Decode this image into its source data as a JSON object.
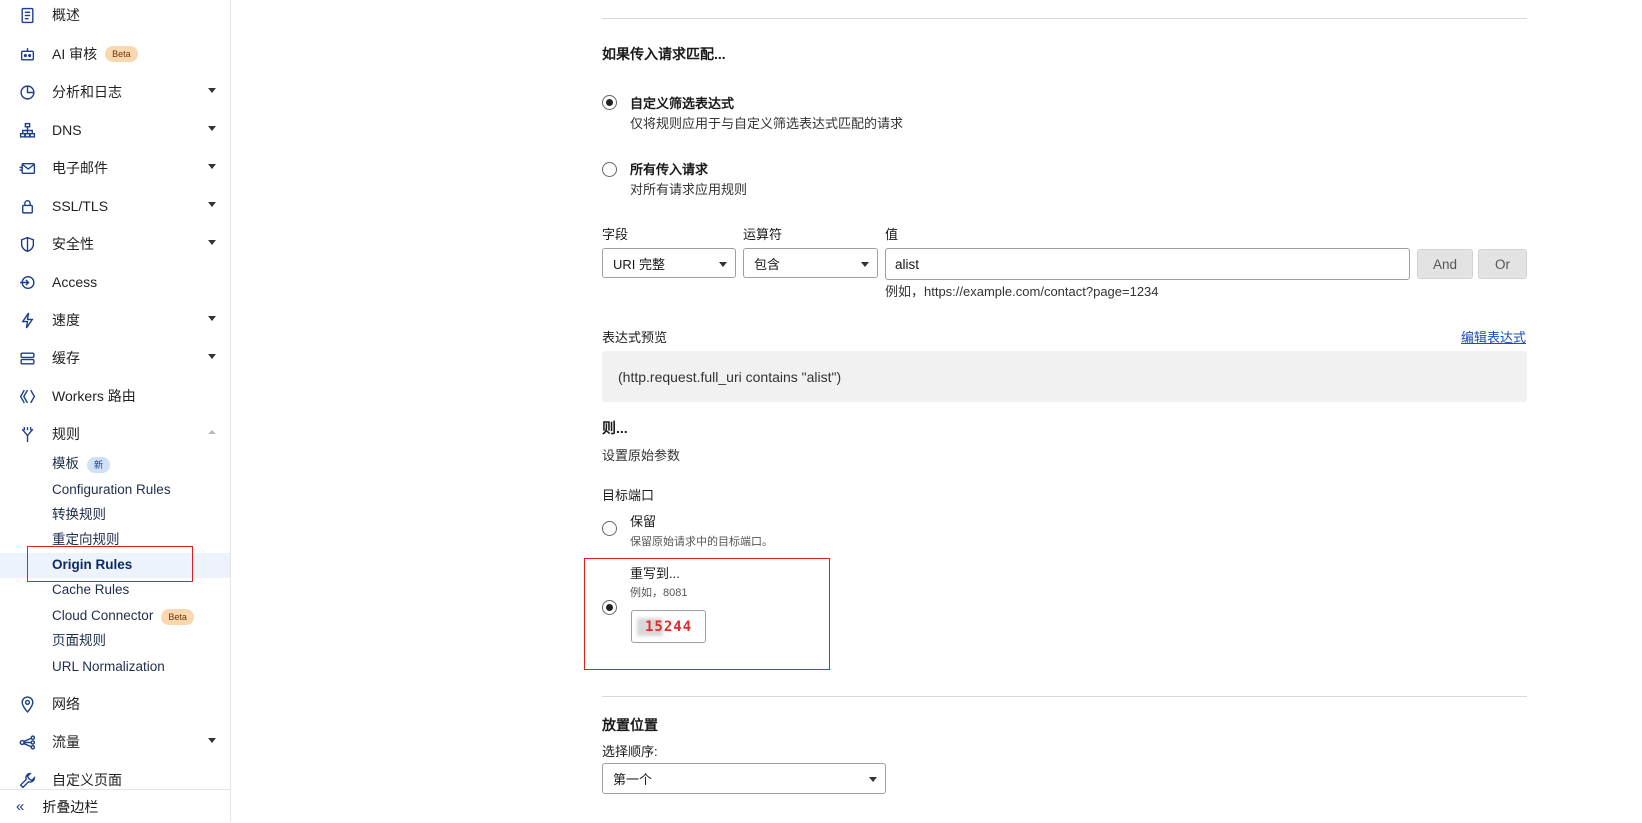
{
  "sidebar": {
    "items": [
      {
        "label": "概述",
        "icon": "document-icon"
      },
      {
        "label": "AI 审核",
        "icon": "robot-icon",
        "badge": "Beta"
      },
      {
        "label": "分析和日志",
        "icon": "chart-pie-icon"
      },
      {
        "label": "DNS",
        "icon": "network-icon"
      },
      {
        "label": "电子邮件",
        "icon": "email-icon"
      },
      {
        "label": "SSL/TLS",
        "icon": "lock-icon"
      },
      {
        "label": "安全性",
        "icon": "shield-icon"
      },
      {
        "label": "Access",
        "icon": "access-icon"
      },
      {
        "label": "速度",
        "icon": "lightning-icon"
      },
      {
        "label": "缓存",
        "icon": "cache-icon"
      },
      {
        "label": "Workers 路由",
        "icon": "workers-icon"
      },
      {
        "label": "规则",
        "icon": "rules-icon"
      },
      {
        "label": "网络",
        "icon": "location-pin-icon"
      },
      {
        "label": "流量",
        "icon": "traffic-icon"
      },
      {
        "label": "自定义页面",
        "icon": "wrench-icon"
      }
    ],
    "rules_sub": [
      {
        "label": "模板",
        "badge": "新"
      },
      {
        "label": "Configuration Rules"
      },
      {
        "label": "转换规则"
      },
      {
        "label": "重定向规则"
      },
      {
        "label": "Origin Rules"
      },
      {
        "label": "Cache Rules"
      },
      {
        "label": "Cloud Connector",
        "badge": "Beta"
      },
      {
        "label": "页面规则"
      },
      {
        "label": "URL Normalization"
      }
    ],
    "collapse_label": "折叠边栏",
    "collapse_icon": "double-chevron-left-icon"
  },
  "main": {
    "match_heading": "如果传入请求匹配...",
    "custom_filter": {
      "title": "自定义筛选表达式",
      "desc": "仅将规则应用于与自定义筛选表达式匹配的请求"
    },
    "all_requests": {
      "title": "所有传入请求",
      "desc": "对所有请求应用规则"
    },
    "field_label": "字段",
    "operator_label": "运算符",
    "value_label": "值",
    "field_value": "URI 完整",
    "operator_value": "包含",
    "value_value": "alist",
    "value_hint": "例如，https://example.com/contact?page=1234",
    "and_label": "And",
    "or_label": "Or",
    "preview_label": "表达式预览",
    "edit_expression": "编辑表达式",
    "preview_text": "(http.request.full_uri contains \"alist\")",
    "then_heading": "则...",
    "then_sub": "设置原始参数",
    "dest_port_label": "目标端口",
    "preserve": {
      "title": "保留",
      "desc": "保留原始请求中的目标端口。"
    },
    "rewrite": {
      "title": "重写到...",
      "desc": "例如，8081"
    },
    "port_value": "15244",
    "placement_heading": "放置位置",
    "order_label": "选择顺序:",
    "order_value": "第一个"
  },
  "colors": {
    "accent": "#1a3e8c",
    "highlight_red": "#e02020",
    "link": "#1a4fb8"
  }
}
